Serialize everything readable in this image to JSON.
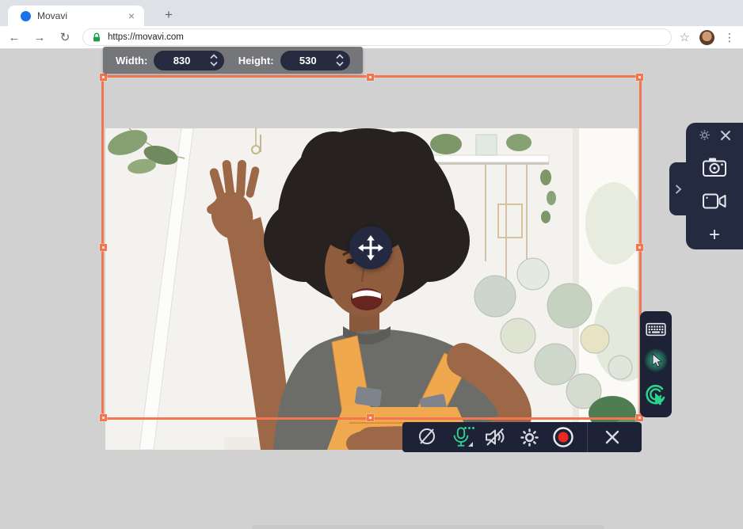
{
  "browser": {
    "tab_title": "Movavi",
    "tab_close": "×",
    "new_tab": "+",
    "back": "←",
    "forward": "→",
    "reload": "↻",
    "url": "https://movavi.com",
    "bookmark": "☆",
    "menu": "⋮"
  },
  "size_toolbar": {
    "width_label": "Width:",
    "width_value": "830",
    "height_label": "Height:",
    "height_value": "530"
  },
  "selection": {
    "capture_width": "830",
    "capture_height": "530",
    "border_color": "#F3764F",
    "handles": [
      "top-left",
      "top-center",
      "top-right",
      "middle-left",
      "middle-right",
      "bottom-left",
      "bottom-center",
      "bottom-right"
    ]
  },
  "side_panel": {
    "collapse_hint": "panel with settings, close, screenshot, webcam and add tools",
    "plus_label": "+",
    "icons": [
      "settings-icon",
      "close-icon",
      "screenshot-camera-icon",
      "webcam-icon",
      "add-icon",
      "collapse-chevron-icon"
    ]
  },
  "effects_panel": {
    "icons": [
      "keyboard-shortcuts-icon",
      "highlight-cursor-icon",
      "highlight-clicks-icon"
    ]
  },
  "record_toolbar": {
    "icons": [
      "webcam-off-icon",
      "microphone-on-icon",
      "system-sound-off-icon",
      "settings-icon",
      "record-icon",
      "close-icon"
    ]
  },
  "photo": {
    "description": "Smiling young woman with large afro hair waving at the camera, wearing an orange dungaree over a gray t-shirt, in a bright room with a white easel pole, hanging plants, a shelf, round wall mirrors and a window"
  },
  "colors": {
    "accent_orange": "#F3764F",
    "panel_navy": "#242A40",
    "toolbar_navy": "#1D2236",
    "mic_green": "#2FD48E",
    "record_red": "#EA2A21",
    "favicon_blue": "#1A73E8",
    "lock_green": "#1E9E4A"
  }
}
